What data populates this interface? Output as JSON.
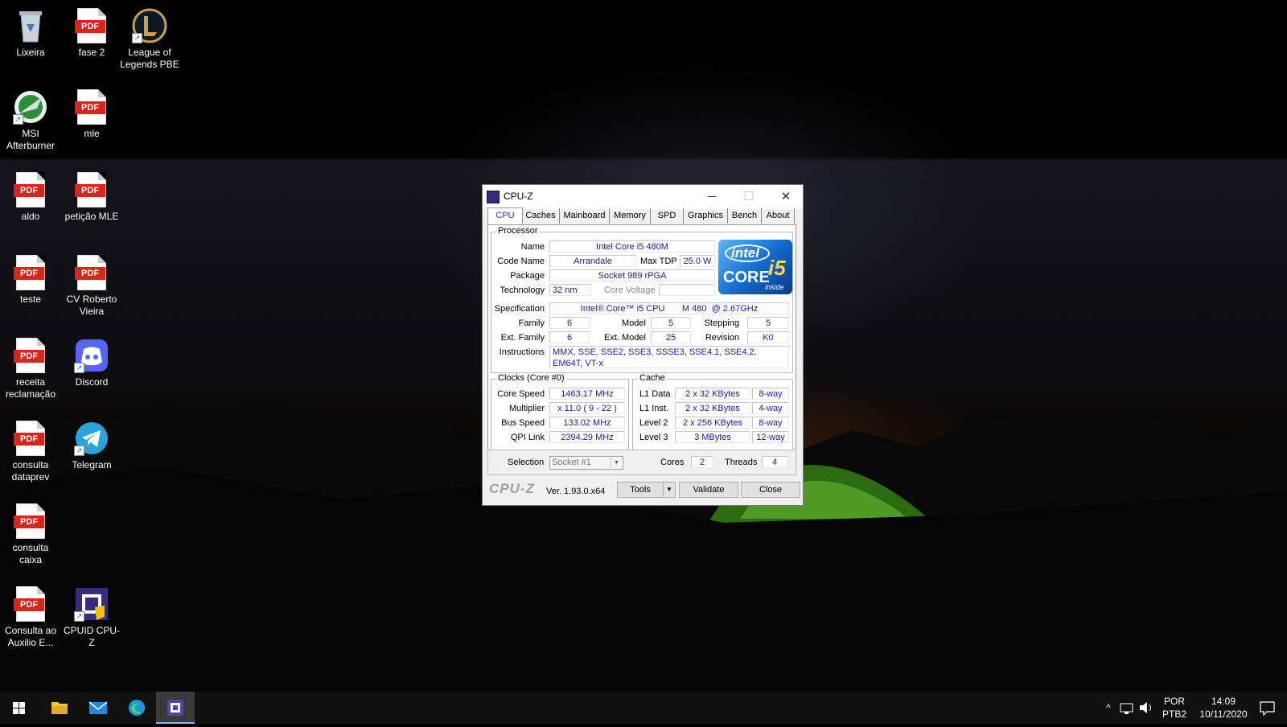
{
  "desktop": {
    "icons": [
      {
        "label": "Lixeira"
      },
      {
        "label": "fase 2"
      },
      {
        "label": "League of Legends PBE"
      },
      {
        "label": "MSI Afterburner"
      },
      {
        "label": "mle"
      },
      {
        "label": "aldo"
      },
      {
        "label": "petição MLE"
      },
      {
        "label": "teste"
      },
      {
        "label": "CV Roberto Vieira"
      },
      {
        "label": "receita reclamação"
      },
      {
        "label": "Discord"
      },
      {
        "label": "consulta dataprev"
      },
      {
        "label": "Telegram"
      },
      {
        "label": "consulta caixa"
      },
      {
        "label": "Consulta ao Auxilio E..."
      },
      {
        "label": "CPUID CPU-Z"
      }
    ],
    "pdf_badge": "PDF"
  },
  "window": {
    "title": "CPU-Z",
    "tabs": [
      "CPU",
      "Caches",
      "Mainboard",
      "Memory",
      "SPD",
      "Graphics",
      "Bench",
      "About"
    ],
    "active_tab": "CPU",
    "processor": {
      "legend": "Processor",
      "name_label": "Name",
      "name": "Intel Core i5 480M",
      "codename_label": "Code Name",
      "codename": "Arrandale",
      "maxtdp_label": "Max TDP",
      "maxtdp": "25.0 W",
      "package_label": "Package",
      "package": "Socket 989 rPGA",
      "technology_label": "Technology",
      "technology": "32 nm",
      "corevoltage_label": "Core Voltage",
      "corevoltage": "",
      "spec_label": "Specification",
      "spec": "Intel® Core™ i5 CPU       M 480  @ 2.67GHz",
      "family_label": "Family",
      "family": "6",
      "model_label": "Model",
      "model": "5",
      "stepping_label": "Stepping",
      "stepping": "5",
      "extfamily_label": "Ext. Family",
      "extfamily": "6",
      "extmodel_label": "Ext. Model",
      "extmodel": "25",
      "revision_label": "Revision",
      "revision": "K0",
      "instructions_label": "Instructions",
      "instructions": "MMX, SSE, SSE2, SSE3, SSSE3, SSE4.1, SSE4.2, EM64T, VT-x",
      "logo": {
        "brand": "intel",
        "line": "CORE",
        "tier": "i5",
        "tag": "inside"
      }
    },
    "clocks": {
      "legend": "Clocks (Core #0)",
      "corespeed_label": "Core Speed",
      "corespeed": "1463.17 MHz",
      "multiplier_label": "Multiplier",
      "multiplier": "x 11.0 ( 9 - 22 )",
      "busspeed_label": "Bus Speed",
      "busspeed": "133.02 MHz",
      "qpilink_label": "QPI Link",
      "qpilink": "2394.29 MHz"
    },
    "cache": {
      "legend": "Cache",
      "rows": [
        {
          "label": "L1 Data",
          "size": "2 x 32 KBytes",
          "way": "8-way"
        },
        {
          "label": "L1 Inst.",
          "size": "2 x 32 KBytes",
          "way": "4-way"
        },
        {
          "label": "Level 2",
          "size": "2 x 256 KBytes",
          "way": "8-way"
        },
        {
          "label": "Level 3",
          "size": "3 MBytes",
          "way": "12-way"
        }
      ]
    },
    "selection": {
      "label": "Selection",
      "value": "Socket #1",
      "cores_label": "Cores",
      "cores": "2",
      "threads_label": "Threads",
      "threads": "4"
    },
    "footer": {
      "logo": "CPU-Z",
      "version": "Ver. 1.93.0.x64",
      "tools": "Tools",
      "validate": "Validate",
      "close": "Close"
    }
  },
  "taskbar": {
    "lang_line1": "POR",
    "lang_line2": "PTB2",
    "time": "14:09",
    "date": "10/11/2020"
  }
}
